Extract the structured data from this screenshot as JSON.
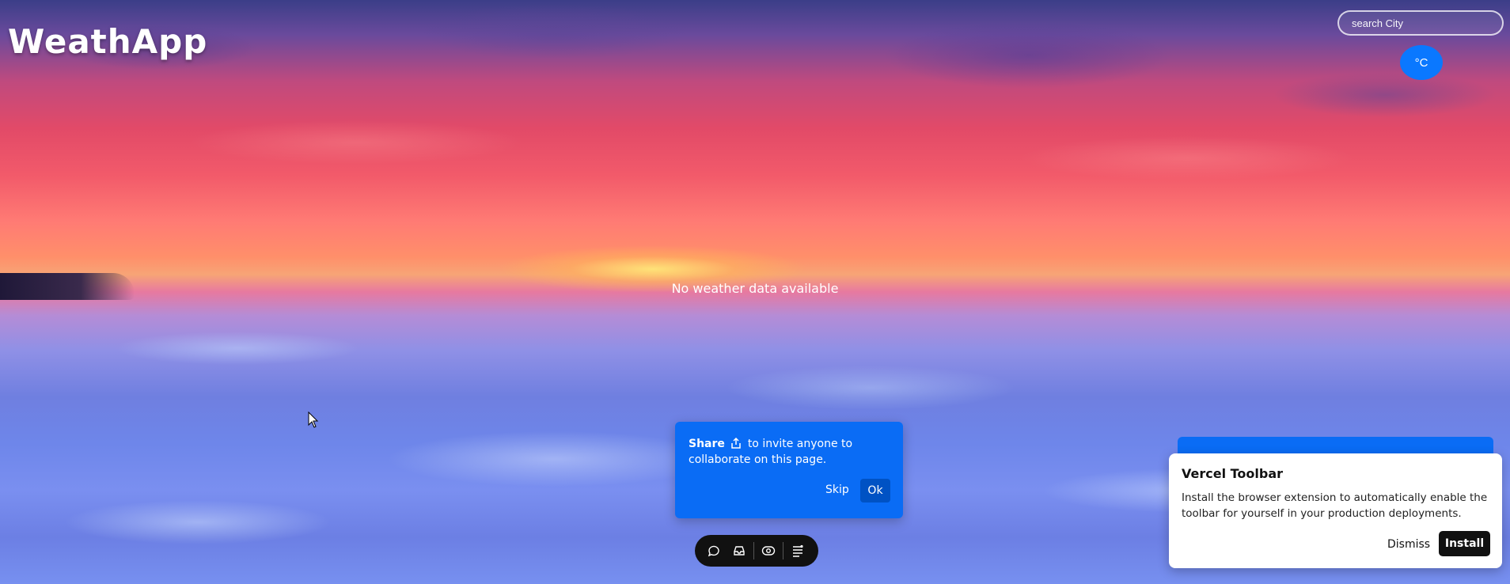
{
  "app": {
    "title": "WeathApp"
  },
  "search": {
    "placeholder": "search City",
    "value": ""
  },
  "unit_toggle": {
    "label": "°C"
  },
  "main": {
    "status": "No weather data available"
  },
  "share_popover": {
    "bold": "Share",
    "text": "to invite anyone to collaborate on this page.",
    "skip_label": "Skip",
    "ok_label": "Ok",
    "icon": "share-icon"
  },
  "toolbar": {
    "icons": [
      "comment-icon",
      "inbox-icon",
      "eye-icon",
      "menu-icon"
    ]
  },
  "vercel_toolbar": {
    "title": "Vercel Toolbar",
    "body": "Install the browser extension to automatically enable the toolbar for yourself in your production deployments.",
    "dismiss_label": "Dismiss",
    "install_label": "Install"
  },
  "colors": {
    "accent": "#0a78ff",
    "popover": "#0a6cf5",
    "toolbar": "#111111"
  }
}
